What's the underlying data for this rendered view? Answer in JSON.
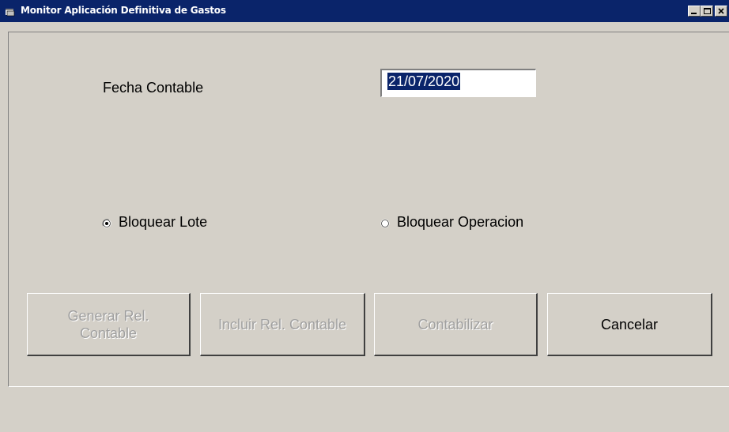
{
  "window": {
    "title": "Monitor Aplicación Definitiva de Gastos"
  },
  "form": {
    "fecha_label": "Fecha Contable",
    "fecha_value": "21/07/2020",
    "radio_lote_label": "Bloquear Lote",
    "radio_lote_selected": true,
    "radio_operacion_label": "Bloquear Operacion",
    "radio_operacion_selected": false
  },
  "buttons": {
    "generar_line1": "Generar Rel.",
    "generar_line2": "Contable",
    "incluir": "Incluir Rel. Contable",
    "contabilizar": "Contabilizar",
    "cancelar": "Cancelar"
  },
  "colors": {
    "titlebar": "#0a246a",
    "face": "#d4d0c8",
    "selection": "#0a246a",
    "disabled_text": "#a0a0a0"
  }
}
